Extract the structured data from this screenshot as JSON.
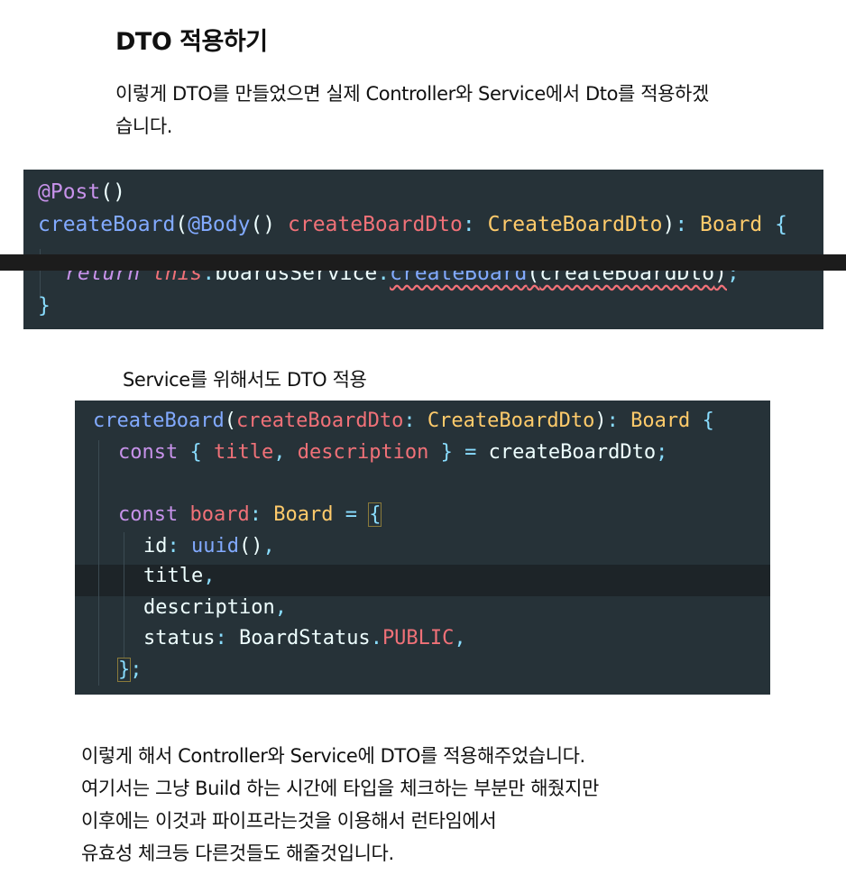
{
  "heading": "DTO 적용하기",
  "intro": [
    "이렇게 DTO를 만들었으면 실제 Controller와 Service에서 Dto를 적용하겠",
    "습니다."
  ],
  "controller_code": {
    "decorator": "@Post",
    "decorator_parens": "()",
    "method": "createBoard",
    "paren_open": "(",
    "body_decorator": "@Body",
    "body_parens": "()",
    "param": "createBoardDto",
    "colon": ":",
    "param_type": "CreateBoardDto",
    "paren_close": ")",
    "return_colon": ":",
    "return_type": "Board",
    "brace_open": "{",
    "kw_return": "return",
    "kw_this": "this",
    "dot1": ".",
    "service": "boardsService",
    "dot2": ".",
    "call": "createBoard",
    "call_open": "(",
    "call_arg": "createBoardDto",
    "call_close": ")",
    "semi": ";",
    "brace_close": "}"
  },
  "service_caption": "Service를 위해서도 DTO 적용",
  "service_code": {
    "method": "createBoard",
    "paren_open": "(",
    "param": "createBoardDto",
    "colon": ":",
    "param_type": "CreateBoardDto",
    "paren_close": ")",
    "return_colon": ":",
    "return_type": "Board",
    "brace_open": "{",
    "kw_const1": "const",
    "destr_open": "{",
    "f_title": "title",
    "comma1": ",",
    "f_desc": "description",
    "destr_close": "}",
    "eq1": "=",
    "source": "createBoardDto",
    "semi1": ";",
    "kw_const2": "const",
    "var_board": "board",
    "colon2": ":",
    "board_type": "Board",
    "eq2": "=",
    "obj_open": "{",
    "key_id": "id",
    "colon3": ":",
    "fn_uuid": "uuid",
    "uuid_parens": "()",
    "comma2": ",",
    "key_title": "title",
    "comma3": ",",
    "key_desc": "description",
    "comma4": ",",
    "key_status": "status",
    "colon4": ":",
    "enum_name": "BoardStatus",
    "dot": ".",
    "enum_val": "PUBLIC",
    "comma5": ",",
    "obj_close": "}",
    "semi2": ";"
  },
  "outro": [
    "이렇게 해서 Controller와 Service에 DTO를 적용해주었습니다.",
    "여기서는 그냥 Build 하는 시간에 타입을 체크하는 부분만 해줬지만",
    "이후에는 이것과 파이프라는것을 이용해서 런타임에서",
    "유효성 체크등 다른것들도 해줄것입니다."
  ],
  "colors": {
    "code_background": "#263238",
    "keyword": "#c792ea",
    "function": "#82aaff",
    "variable": "#f07178",
    "type": "#ffcb6b",
    "operator": "#89ddff",
    "text": "#eeffff"
  }
}
